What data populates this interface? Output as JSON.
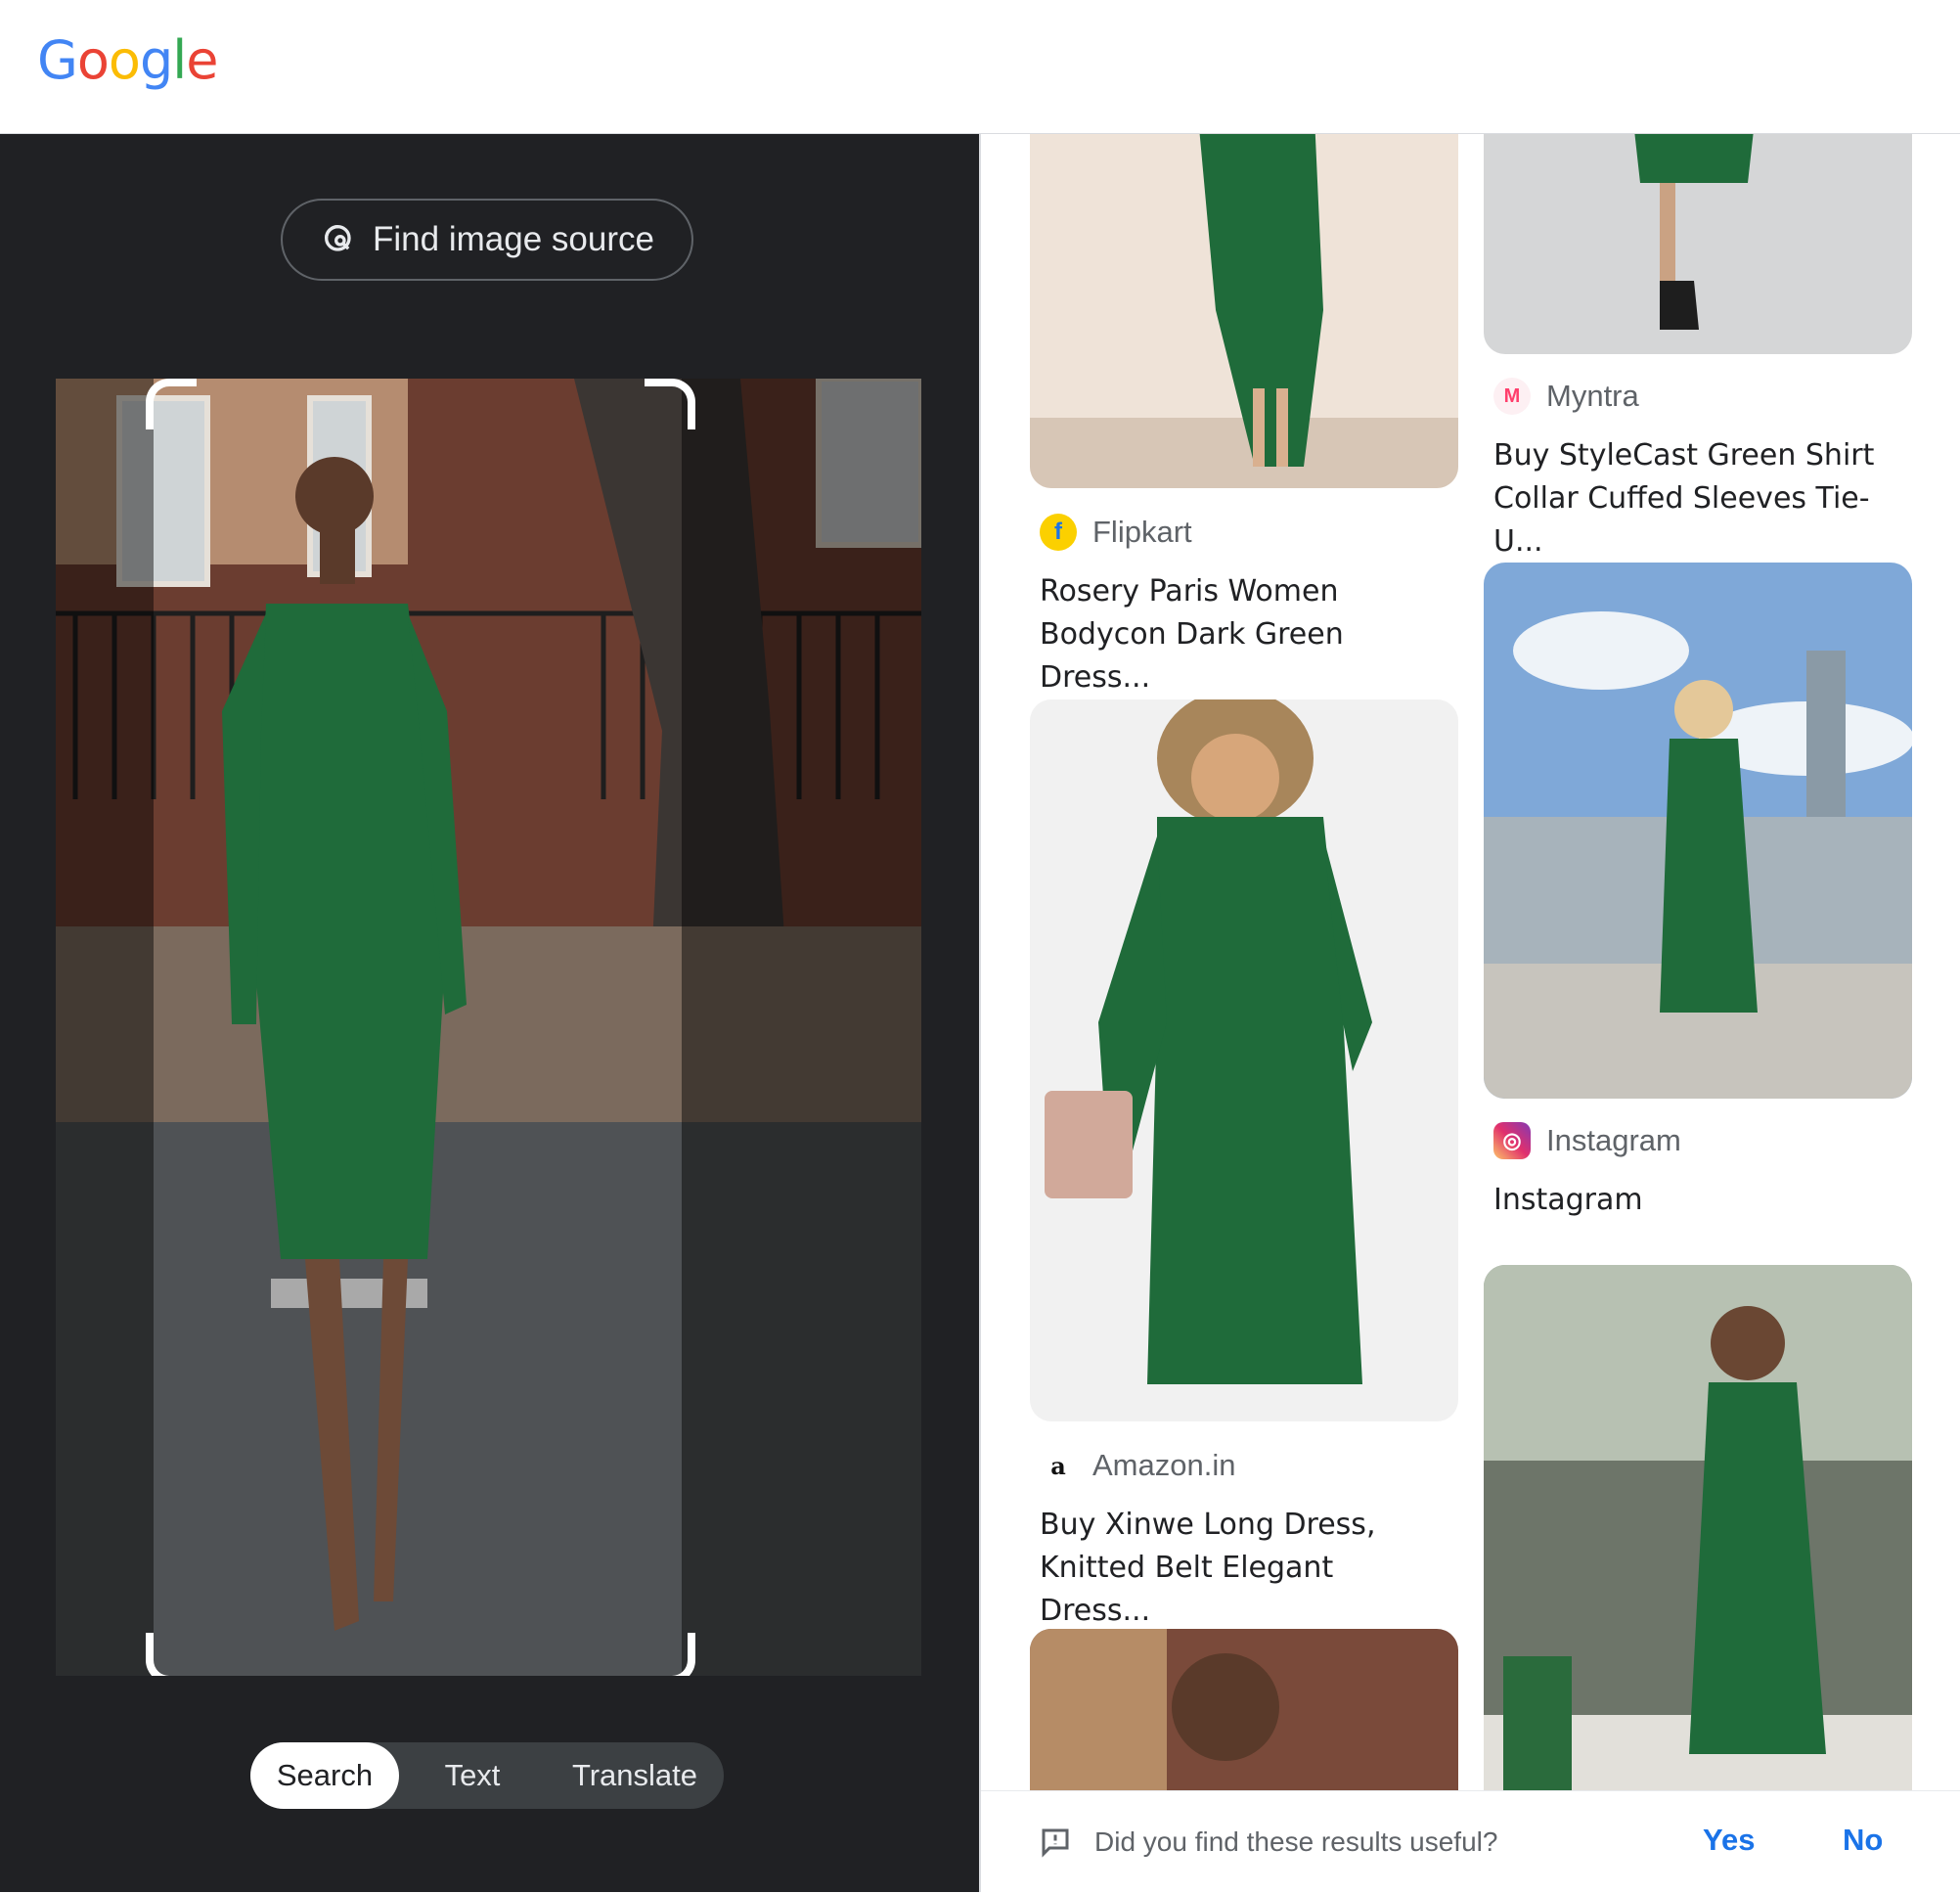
{
  "header": {
    "logo_letters": [
      {
        "char": "G",
        "color": "#4285F4"
      },
      {
        "char": "o",
        "color": "#EA4335"
      },
      {
        "char": "o",
        "color": "#FBBC05"
      },
      {
        "char": "g",
        "color": "#4285F4"
      },
      {
        "char": "l",
        "color": "#34A853"
      },
      {
        "char": "e",
        "color": "#EA4335"
      }
    ]
  },
  "left_panel": {
    "find_source_label": "Find image source",
    "find_source_icon": "image-search-icon",
    "modes": [
      {
        "label": "Search",
        "active": true
      },
      {
        "label": "Text",
        "active": false
      },
      {
        "label": "Translate",
        "active": false
      }
    ]
  },
  "results": [
    {
      "source": "Flipkart",
      "favicon": "flipkart-icon",
      "title": "Rosery Paris Women Bodycon Dark Green Dress..."
    },
    {
      "source": "Myntra",
      "favicon": "myntra-icon",
      "title": "Buy StyleCast Green Shirt Collar Cuffed Sleeves Tie-U..."
    },
    {
      "source": "Instagram",
      "favicon": "instagram-icon",
      "title": "Instagram"
    },
    {
      "source": "Amazon.in",
      "favicon": "amazon-icon",
      "title": "Buy Xinwe Long Dress, Knitted Belt Elegant Dress..."
    }
  ],
  "feedback": {
    "question": "Did you find these results useful?",
    "yes": "Yes",
    "no": "No"
  },
  "colors": {
    "dark_panel": "#202124",
    "dress_green": "#1f6b3a",
    "link_blue": "#1a73e8"
  }
}
